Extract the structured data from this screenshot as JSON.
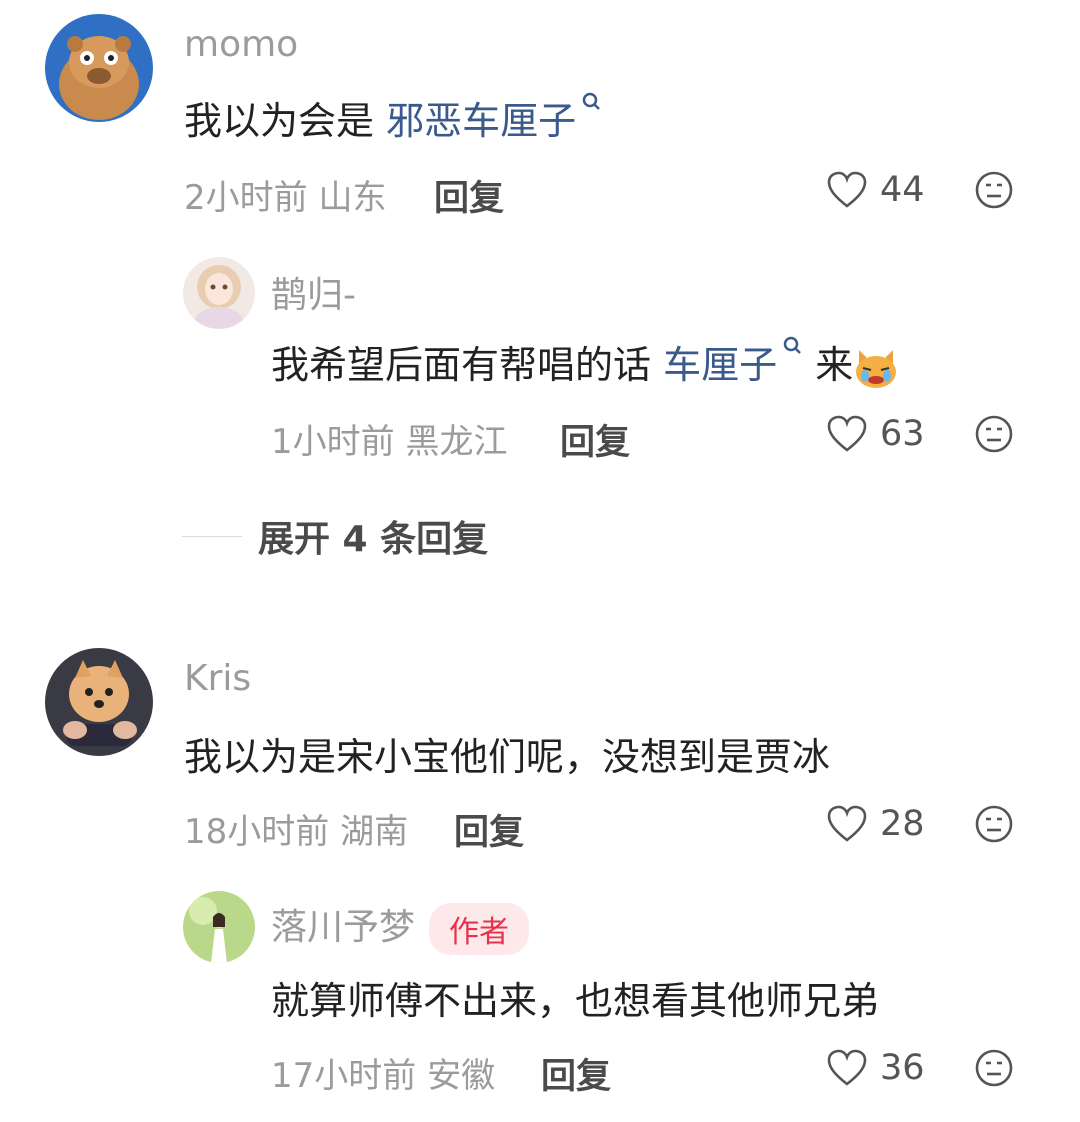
{
  "comments": [
    {
      "user": "momo",
      "text": "我以为会是 ",
      "link": "邪恶车厘子",
      "text_after": "",
      "time": "2小时前",
      "location": "山东",
      "reply_label": "回复",
      "likes": "44"
    },
    {
      "user": "鹊归-",
      "text": "我希望后面有帮唱的话 ",
      "link": "车厘子",
      "text_after": " 来",
      "time": "1小时前",
      "location": "黑龙江",
      "reply_label": "回复",
      "likes": "63"
    },
    {
      "user": "Kris",
      "text": "我以为是宋小宝他们呢，没想到是贾冰",
      "time": "18小时前",
      "location": "湖南",
      "reply_label": "回复",
      "likes": "28"
    },
    {
      "user": "落川予梦",
      "badge": "作者",
      "text": "就算师傅不出来，也想看其他师兄弟",
      "time": "17小时前",
      "location": "安徽",
      "reply_label": "回复",
      "likes": "36"
    }
  ],
  "expand_label": "展开 4 条回复",
  "icons": [
    "heart-icon",
    "meh-face-icon",
    "search-icon",
    "crying-cat-emoji"
  ],
  "colors": {
    "link": "#3a5a8c",
    "badge_bg": "#fde8ea",
    "badge_text": "#e6334b",
    "meta": "#9b9b9b"
  }
}
